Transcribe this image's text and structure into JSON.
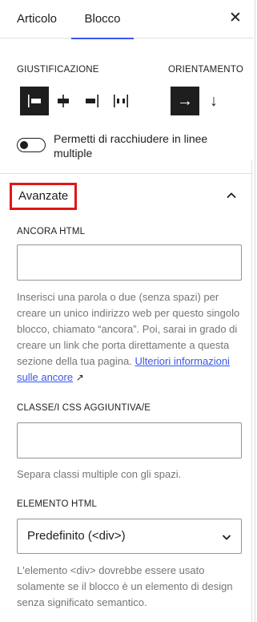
{
  "tabs": {
    "article": "Articolo",
    "block": "Blocco",
    "close_icon": "close-icon"
  },
  "layout": {
    "justification_label": "GIUSTIFICAZIONE",
    "orientation_label": "ORIENTAMENTO",
    "justification_options": [
      {
        "name": "justify-left",
        "active": true
      },
      {
        "name": "justify-center",
        "active": false
      },
      {
        "name": "justify-right",
        "active": false
      },
      {
        "name": "justify-space-between",
        "active": false
      }
    ],
    "orientation_options": [
      {
        "name": "horizontal-arrow",
        "glyph": "→",
        "active": true
      },
      {
        "name": "vertical-arrow",
        "glyph": "↓",
        "active": false
      }
    ],
    "wrap_toggle_label": "Permetti di racchiudere in linee multiple",
    "wrap_toggle_on": false
  },
  "advanced": {
    "title": "Avanzate",
    "highlight_color": "#e11616",
    "anchor": {
      "label": "ANCORA HTML",
      "value": "",
      "help_text": "Inserisci una parola o due (senza spazi) per creare un unico indirizzo web per questo singolo blocco, chiamato “ancora”. Poi, sarai in grado di creare un link che porta direttamente a questa sezione della tua pagina. ",
      "link_text": "Ulteriori informazioni sulle ancore",
      "link_icon": "↗"
    },
    "css_class": {
      "label": "CLASSE/I CSS AGGIUNTIVA/E",
      "value": "",
      "help_text": "Separa classi multiple con gli spazi."
    },
    "html_element": {
      "label": "ELEMENTO HTML",
      "selected": "Predefinito (<div>)",
      "help_text": "L'elemento <div> dovrebbe essere usato solamente se il blocco è un elemento di design senza significato semantico."
    }
  },
  "colors": {
    "accent": "#3858e9",
    "text": "#1e1e1e",
    "muted": "#757575"
  }
}
